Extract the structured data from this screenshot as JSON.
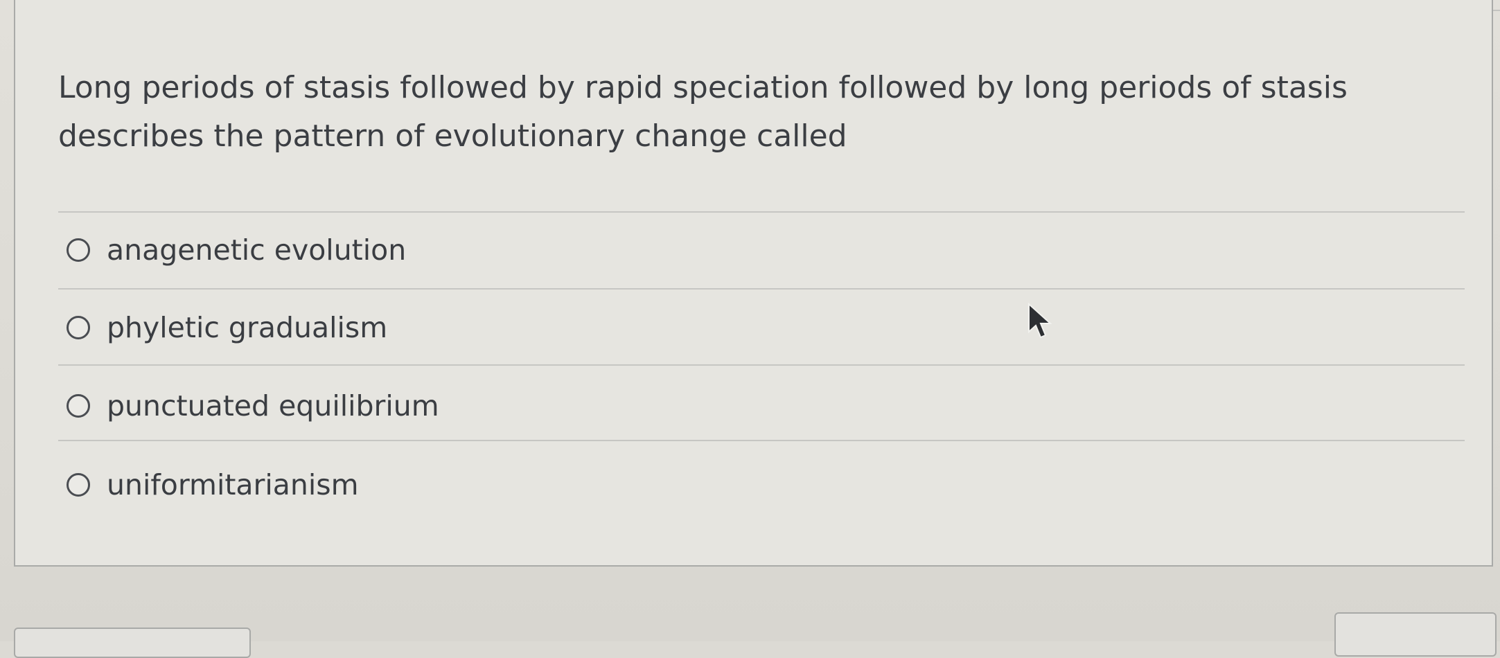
{
  "question": {
    "text": "Long periods of stasis followed by rapid speciation followed by long periods of stasis describes the pattern of evolutionary change called"
  },
  "answers": [
    {
      "label": "anagenetic evolution",
      "selected": false
    },
    {
      "label": "phyletic gradualism",
      "selected": false
    },
    {
      "label": "punctuated equilibrium",
      "selected": false
    },
    {
      "label": "uniformitarianism",
      "selected": false
    }
  ],
  "icons": {
    "radio": "radio-unchecked-icon",
    "cursor": "mouse-pointer-icon"
  },
  "colors": {
    "background": "#dcdad4",
    "card": "#e6e5e0",
    "text": "#3a3d42",
    "border": "#a9aaa8"
  }
}
